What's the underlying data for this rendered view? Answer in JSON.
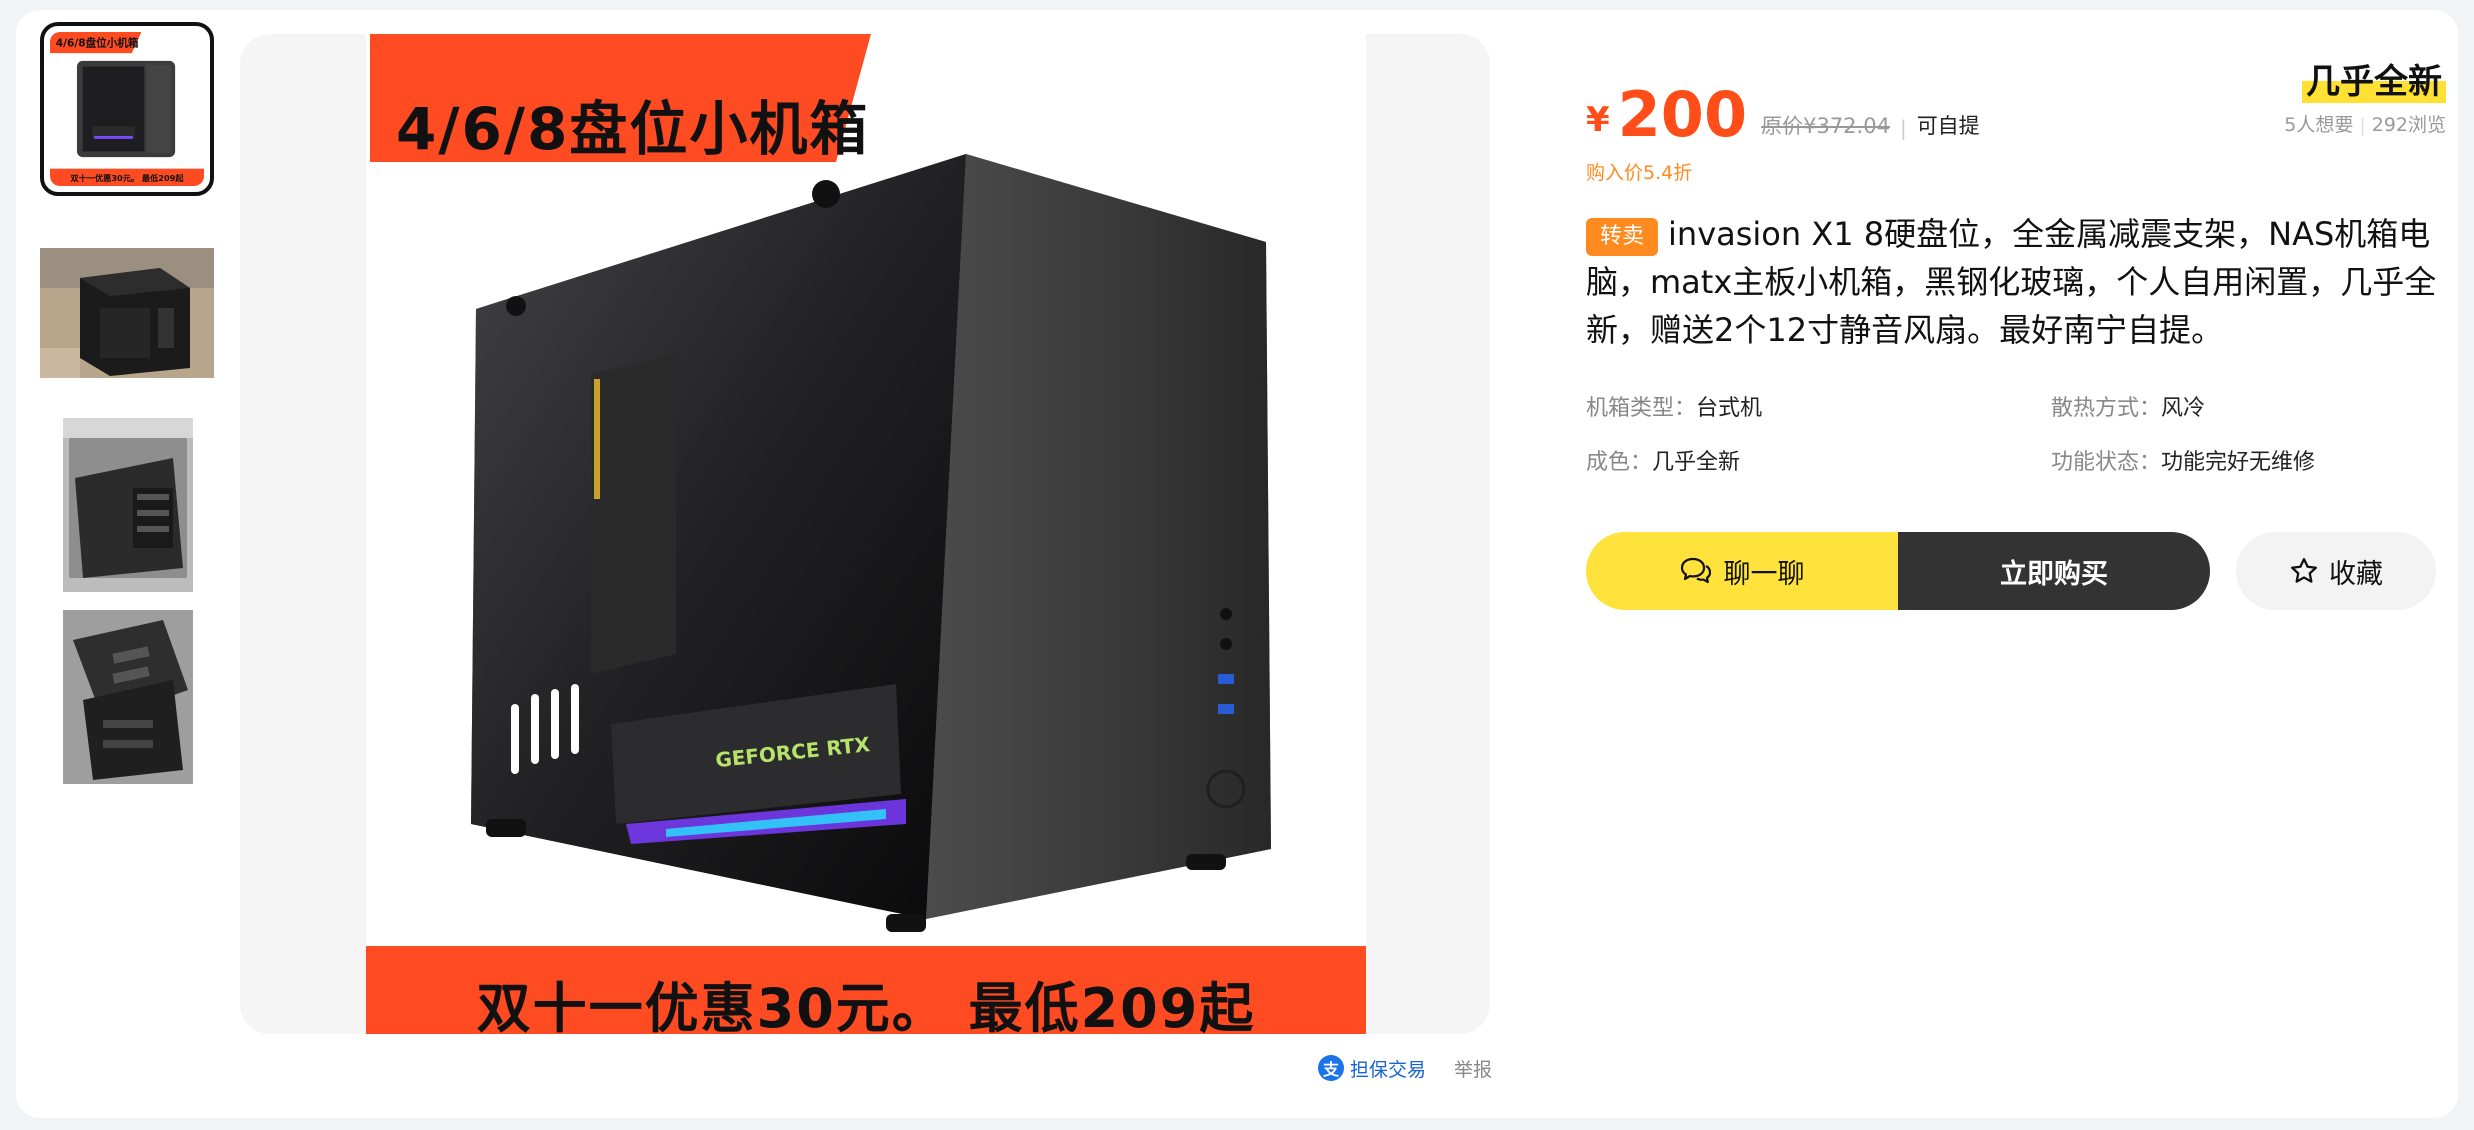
{
  "gallery": {
    "thumb1_banner_top": "4/6/8盘位小机箱",
    "thumb1_banner_bottom": "双十一优惠30元。 最低209起",
    "main_banner_top": "4/6/8盘位小机箱",
    "main_banner_bottom": "双十一优惠30元。 最低209起",
    "main_gpu_label": "GEFORCE RTX"
  },
  "links": {
    "guarantee": "担保交易",
    "guarantee_icon_char": "支",
    "report": "举报"
  },
  "price": {
    "currency": "¥",
    "value": "200",
    "original": "原价¥372.04",
    "pickup": "可自提",
    "discount": "购入价5.4折"
  },
  "condition_badge": "几乎全新",
  "stats": {
    "wants": "5人想要",
    "views": "292浏览"
  },
  "listing": {
    "tag": "转卖",
    "title": "invasion X1 8硬盘位，全金属减震支架，NAS机箱电脑，matx主板小机箱，黑钢化玻璃，个人自用闲置，几乎全新，赠送2个12寸静音风扇。最好南宁自提。"
  },
  "attributes": [
    {
      "key": "机箱类型：",
      "value": "台式机"
    },
    {
      "key": "散热方式：",
      "value": "风冷"
    },
    {
      "key": "成色：",
      "value": "几乎全新"
    },
    {
      "key": "功能状态：",
      "value": "功能完好无维修"
    }
  ],
  "buttons": {
    "chat": "聊一聊",
    "buy": "立即购买",
    "favorite": "收藏"
  },
  "colors": {
    "accent_orange": "#ff4d1a",
    "tag_orange": "#ff8a1f",
    "chat_yellow": "#ffe33c",
    "buy_dark": "#333333",
    "link_blue": "#1663d9"
  }
}
